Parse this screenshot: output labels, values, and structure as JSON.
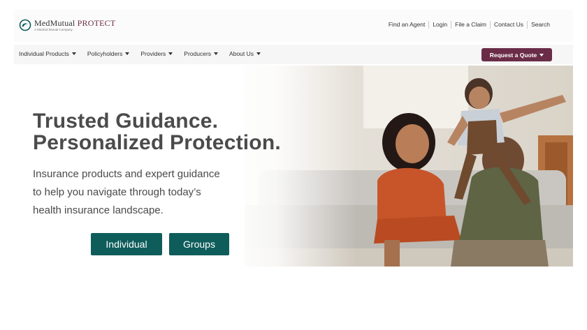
{
  "brand": {
    "name_primary": "MedMutual",
    "name_accent": "PROTECT",
    "tagline": "A Medical Mutual Company",
    "colors": {
      "accent": "#6a2c47",
      "cta": "#0e5d5b"
    }
  },
  "utility_nav": {
    "links": [
      "Find an Agent",
      "Login",
      "File a Claim",
      "Contact Us",
      "Search"
    ]
  },
  "main_nav": {
    "items": [
      "Individual Products",
      "Policyholders",
      "Providers",
      "Producers",
      "About Us"
    ],
    "quote_button": "Request a Quote"
  },
  "hero": {
    "headline_line1": "Trusted Guidance.",
    "headline_line2": "Personalized Protection.",
    "body_line1": "Insurance products and expert guidance",
    "body_line2": "to help you navigate through today’s",
    "body_line3": "health insurance landscape.",
    "buttons": {
      "individual": "Individual",
      "groups": "Groups"
    },
    "image": "family-on-couch-photo"
  }
}
